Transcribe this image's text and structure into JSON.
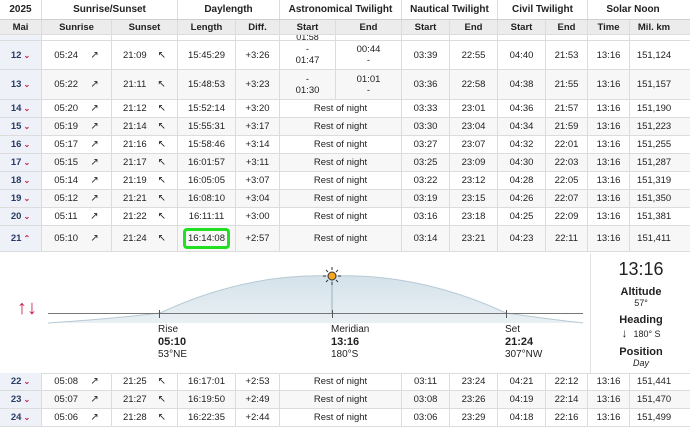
{
  "header_groups": {
    "year": "2025",
    "sunrise_sunset": "Sunrise/Sunset",
    "daylength": "Daylength",
    "astro": "Astronomical Twilight",
    "nautical": "Nautical Twilight",
    "civil": "Civil Twilight",
    "solar_noon": "Solar Noon"
  },
  "header_cols": {
    "month": "Mai",
    "sunrise": "Sunrise",
    "sunset": "Sunset",
    "length": "Length",
    "diff": "Diff.",
    "astro_start": "Start",
    "astro_end": "End",
    "naut_start": "Start",
    "naut_end": "End",
    "civil_start": "Start",
    "civil_end": "End",
    "time": "Time",
    "mil_km": "Mil. km"
  },
  "partial_top": {
    "astro_start": "01:58"
  },
  "rows_top": [
    {
      "day": "12",
      "sunrise": "05:24",
      "sunset": "21:09",
      "length": "15:45:29",
      "diff": "+3:26",
      "astro_start_a": "-",
      "astro_start_b": "01:47",
      "astro_end_a": "00:44",
      "astro_end_b": "-",
      "naut_start": "03:39",
      "naut_end": "22:55",
      "civil_start": "04:40",
      "civil_end": "21:53",
      "noon": "13:16",
      "km": "151,124"
    },
    {
      "day": "13",
      "sunrise": "05:22",
      "sunset": "21:11",
      "length": "15:48:53",
      "diff": "+3:23",
      "astro_start_a": "-",
      "astro_start_b": "01:30",
      "astro_end_a": "01:01",
      "astro_end_b": "-",
      "naut_start": "03:36",
      "naut_end": "22:58",
      "civil_start": "04:38",
      "civil_end": "21:55",
      "noon": "13:16",
      "km": "151,157"
    }
  ],
  "rows_mid": [
    {
      "day": "14",
      "sunrise": "05:20",
      "sunset": "21:12",
      "length": "15:52:14",
      "diff": "+3:20",
      "astro": "Rest of night",
      "naut_start": "03:33",
      "naut_end": "23:01",
      "civil_start": "04:36",
      "civil_end": "21:57",
      "noon": "13:16",
      "km": "151,190"
    },
    {
      "day": "15",
      "sunrise": "05:19",
      "sunset": "21:14",
      "length": "15:55:31",
      "diff": "+3:17",
      "astro": "Rest of night",
      "naut_start": "03:30",
      "naut_end": "23:04",
      "civil_start": "04:34",
      "civil_end": "21:59",
      "noon": "13:16",
      "km": "151,223"
    },
    {
      "day": "16",
      "sunrise": "05:17",
      "sunset": "21:16",
      "length": "15:58:46",
      "diff": "+3:14",
      "astro": "Rest of night",
      "naut_start": "03:27",
      "naut_end": "23:07",
      "civil_start": "04:32",
      "civil_end": "22:01",
      "noon": "13:16",
      "km": "151,255"
    },
    {
      "day": "17",
      "sunrise": "05:15",
      "sunset": "21:17",
      "length": "16:01:57",
      "diff": "+3:11",
      "astro": "Rest of night",
      "naut_start": "03:25",
      "naut_end": "23:09",
      "civil_start": "04:30",
      "civil_end": "22:03",
      "noon": "13:16",
      "km": "151,287"
    },
    {
      "day": "18",
      "sunrise": "05:14",
      "sunset": "21:19",
      "length": "16:05:05",
      "diff": "+3:07",
      "astro": "Rest of night",
      "naut_start": "03:22",
      "naut_end": "23:12",
      "civil_start": "04:28",
      "civil_end": "22:05",
      "noon": "13:16",
      "km": "151,319"
    },
    {
      "day": "19",
      "sunrise": "05:12",
      "sunset": "21:21",
      "length": "16:08:10",
      "diff": "+3:04",
      "astro": "Rest of night",
      "naut_start": "03:19",
      "naut_end": "23:15",
      "civil_start": "04:26",
      "civil_end": "22:07",
      "noon": "13:16",
      "km": "151,350"
    },
    {
      "day": "20",
      "sunrise": "05:11",
      "sunset": "21:22",
      "length": "16:11:11",
      "diff": "+3:00",
      "astro": "Rest of night",
      "naut_start": "03:16",
      "naut_end": "23:18",
      "civil_start": "04:25",
      "civil_end": "22:09",
      "noon": "13:16",
      "km": "151,381"
    },
    {
      "day": "21",
      "sunrise": "05:10",
      "sunset": "21:24",
      "length": "16:14:08",
      "diff": "+2:57",
      "astro": "Rest of night",
      "naut_start": "03:14",
      "naut_end": "23:21",
      "civil_start": "04:23",
      "civil_end": "22:11",
      "noon": "13:16",
      "km": "151,411"
    }
  ],
  "panel": {
    "rise_label": "Rise",
    "rise_time": "05:10",
    "rise_dir": "53°NE",
    "meridian_label": "Meridian",
    "meridian_time": "13:16",
    "meridian_dir": "180°S",
    "set_label": "Set",
    "set_time": "21:24",
    "set_dir": "307°NW",
    "side_time": "13:16",
    "altitude_label": "Altitude",
    "altitude_value": "57°",
    "heading_label": "Heading",
    "heading_value": "180° S",
    "position_label": "Position",
    "position_value": "Day"
  },
  "rows_bottom": [
    {
      "day": "22",
      "sunrise": "05:08",
      "sunset": "21:25",
      "length": "16:17:01",
      "diff": "+2:53",
      "astro": "Rest of night",
      "naut_start": "03:11",
      "naut_end": "23:24",
      "civil_start": "04:21",
      "civil_end": "22:12",
      "noon": "13:16",
      "km": "151,441"
    },
    {
      "day": "23",
      "sunrise": "05:07",
      "sunset": "21:27",
      "length": "16:19:50",
      "diff": "+2:49",
      "astro": "Rest of night",
      "naut_start": "03:08",
      "naut_end": "23:26",
      "civil_start": "04:19",
      "civil_end": "22:14",
      "noon": "13:16",
      "km": "151,470"
    },
    {
      "day": "24",
      "sunrise": "05:06",
      "sunset": "21:28",
      "length": "16:22:35",
      "diff": "+2:44",
      "astro": "Rest of night",
      "naut_start": "03:06",
      "naut_end": "23:29",
      "civil_start": "04:18",
      "civil_end": "22:16",
      "noon": "13:16",
      "km": "151,499"
    }
  ],
  "colors": {
    "accent": "#d02050",
    "highlight": "#21e021",
    "daycell": "#eef1f7"
  }
}
